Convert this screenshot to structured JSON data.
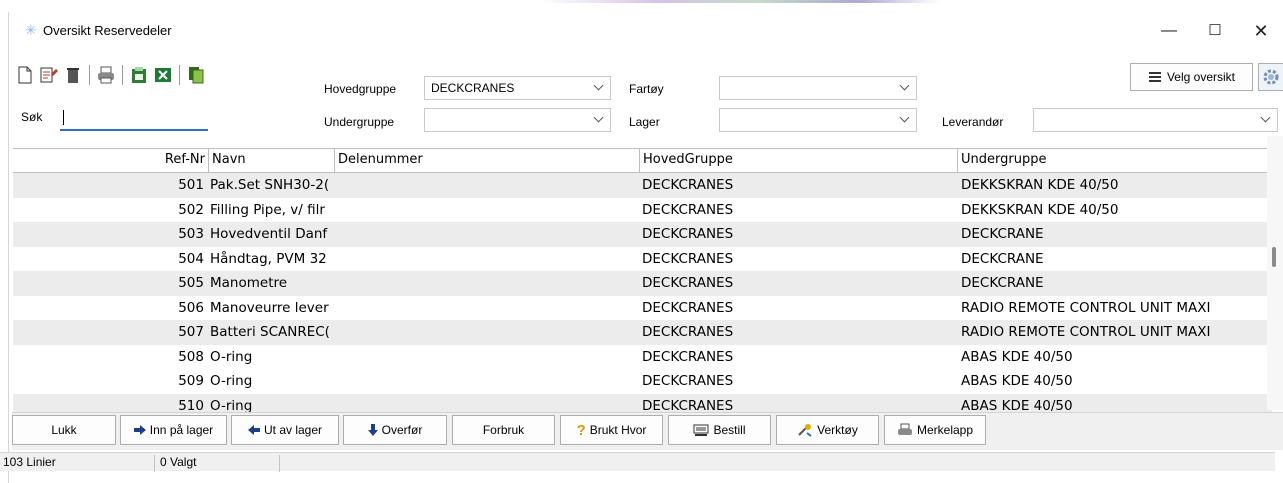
{
  "window": {
    "title": "Oversikt Reservedeler",
    "minimize": "—",
    "maximize": "☐",
    "close": "✕"
  },
  "filters": {
    "hovedgruppe_label": "Hovedgruppe",
    "hovedgruppe_value": "DECKCRANES",
    "undergruppe_label": "Undergruppe",
    "undergruppe_value": "",
    "fartoy_label": "Fartøy",
    "fartoy_value": "",
    "lager_label": "Lager",
    "lager_value": "",
    "leverandor_label": "Leverandør",
    "leverandor_value": "",
    "search_label": "Søk",
    "search_value": ""
  },
  "velg_oversikt_label": "Velg oversikt",
  "grid": {
    "columns": [
      "Ref-Nr",
      "Navn",
      "Delenummer",
      "HovedGruppe",
      "Undergruppe"
    ],
    "rows": [
      {
        "ref": "501",
        "navn": "Pak.Set SNH30-2(",
        "del": "",
        "hg": "DECKCRANES",
        "ug": "DEKKSKRAN KDE 40/50"
      },
      {
        "ref": "502",
        "navn": "Filling Pipe, v/ filr",
        "del": "",
        "hg": "DECKCRANES",
        "ug": "DEKKSKRAN KDE 40/50"
      },
      {
        "ref": "503",
        "navn": "Hovedventil  Danf",
        "del": "",
        "hg": "DECKCRANES",
        "ug": "DECKCRANE"
      },
      {
        "ref": "504",
        "navn": "Håndtag,  PVM 32",
        "del": "",
        "hg": "DECKCRANES",
        "ug": "DECKCRANE"
      },
      {
        "ref": "505",
        "navn": "Manometre",
        "del": "",
        "hg": "DECKCRANES",
        "ug": "DECKCRANE"
      },
      {
        "ref": "506",
        "navn": "Manoveurre lever",
        "del": "",
        "hg": "DECKCRANES",
        "ug": "RADIO REMOTE CONTROL UNIT MAXI"
      },
      {
        "ref": "507",
        "navn": "Batteri SCANREC(",
        "del": "",
        "hg": "DECKCRANES",
        "ug": "RADIO REMOTE CONTROL UNIT MAXI"
      },
      {
        "ref": "508",
        "navn": "O-ring",
        "del": "",
        "hg": "DECKCRANES",
        "ug": "ABAS KDE 40/50"
      },
      {
        "ref": "509",
        "navn": "O-ring",
        "del": "",
        "hg": "DECKCRANES",
        "ug": "ABAS KDE 40/50"
      },
      {
        "ref": "510",
        "navn": "O-ring",
        "del": "",
        "hg": "DECKCRANES",
        "ug": "ABAS KDE 40/50"
      }
    ]
  },
  "actions": {
    "lukk": "Lukk",
    "inn_pa_lager": "Inn på lager",
    "ut_av_lager": "Ut av lager",
    "overfor": "Overfør",
    "forbruk": "Forbruk",
    "brukt_hvor": "Brukt Hvor",
    "bestill": "Bestill",
    "verktoy": "Verktøy",
    "merkelapp": "Merkelapp"
  },
  "status": {
    "lines": "103 Linier",
    "selected": "0 Valgt"
  },
  "colors": {
    "row_alt": "#ececec",
    "accent": "#2f6fbf"
  }
}
